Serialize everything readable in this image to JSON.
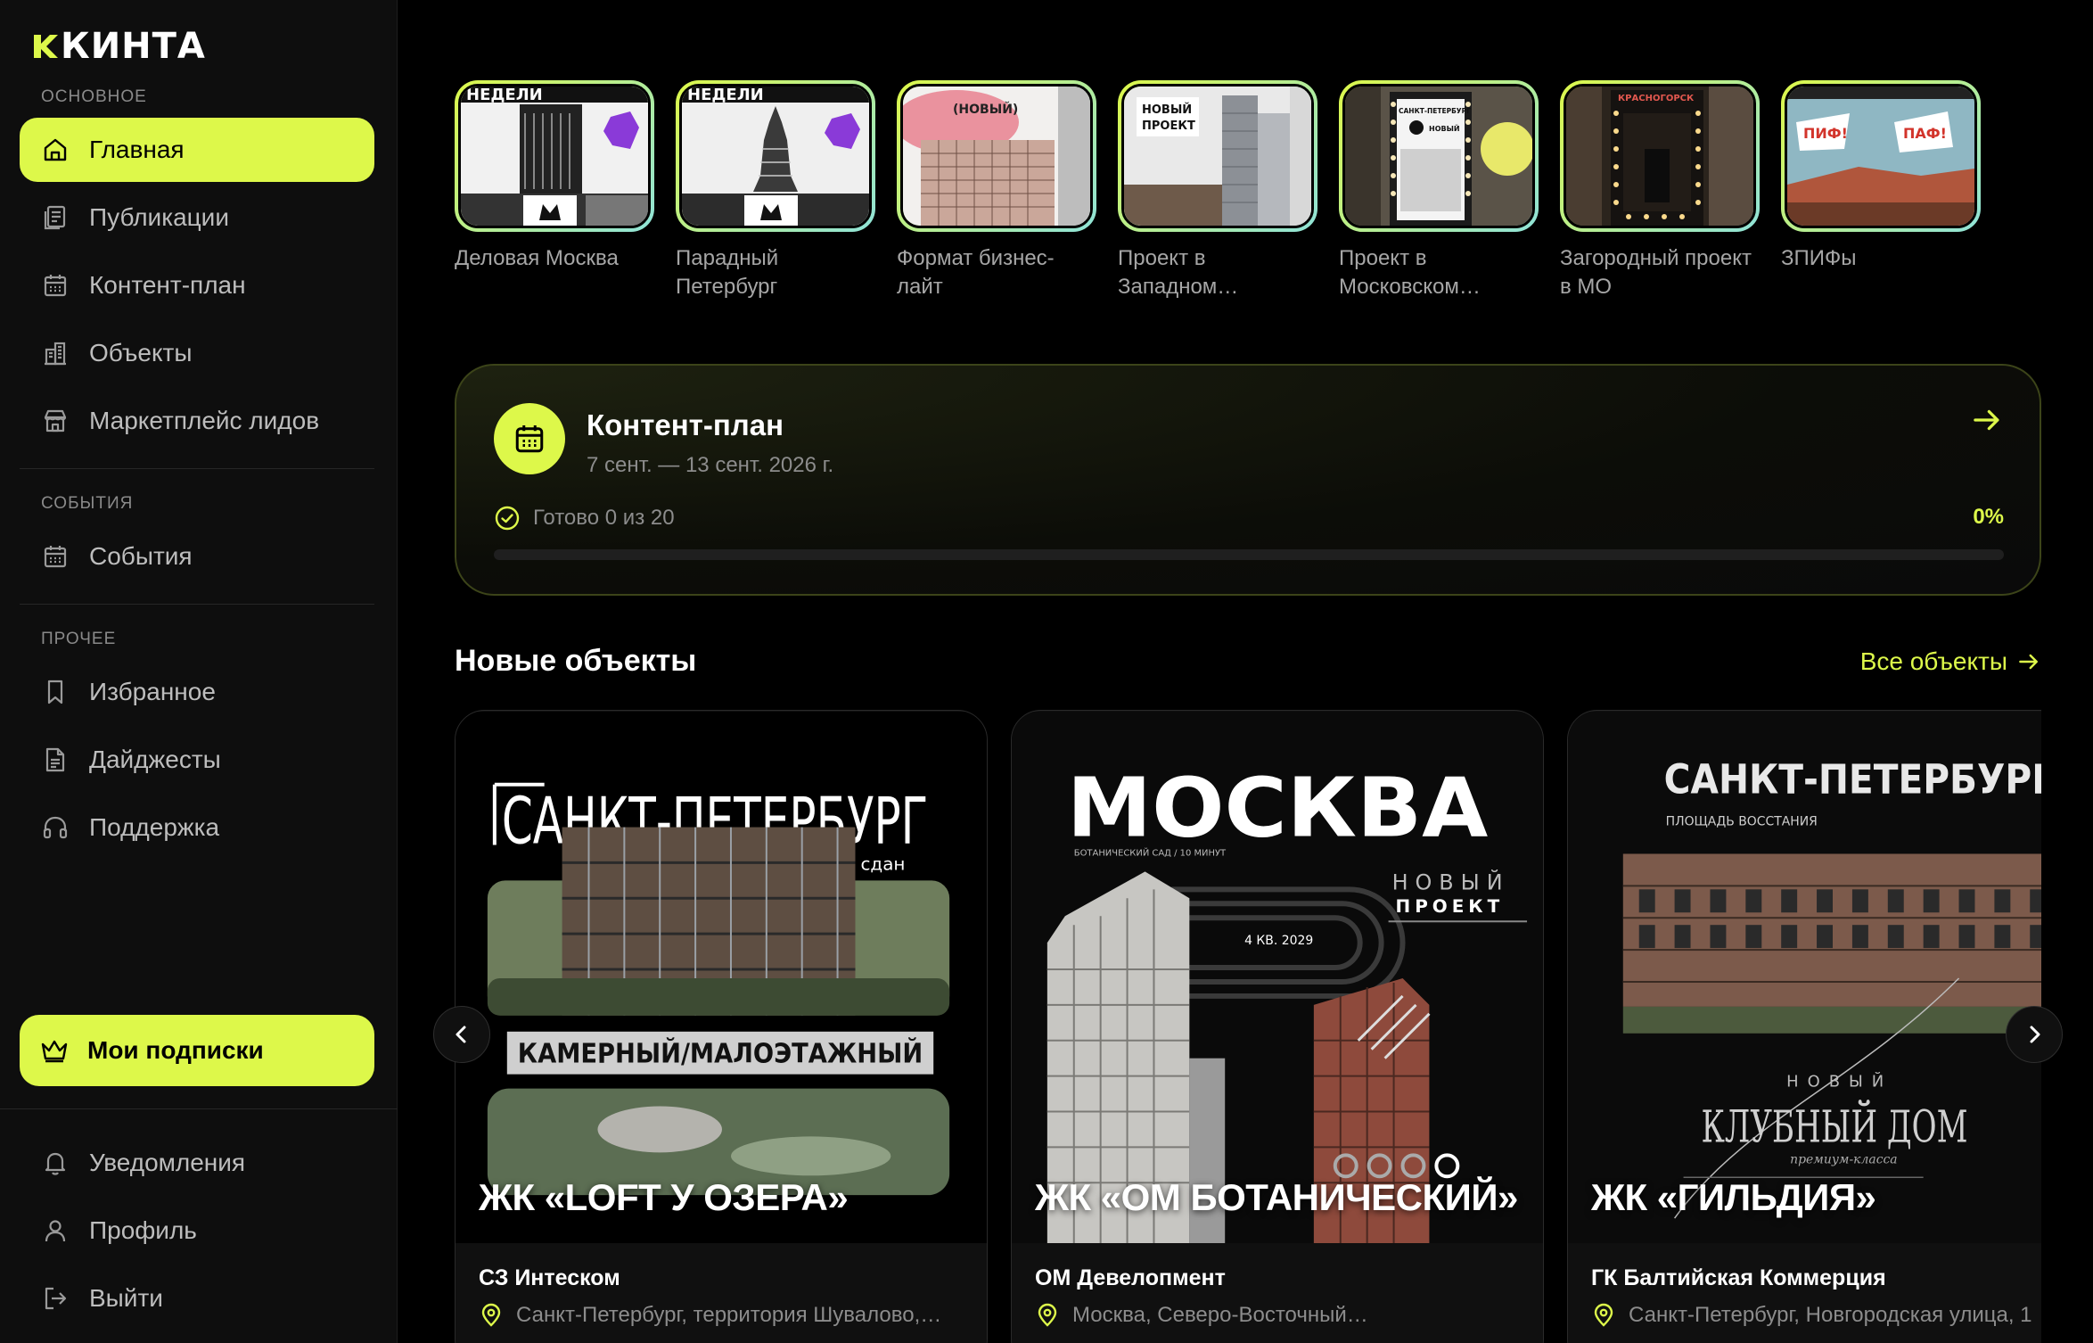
{
  "brand": {
    "name": "КИНТА",
    "accent": "#DDF84A"
  },
  "sidebar": {
    "sections": {
      "main": "ОСНОВНОЕ",
      "events": "СОБЫТИЯ",
      "other": "ПРОЧЕЕ"
    },
    "items": [
      {
        "label": "Главная",
        "icon": "home-icon",
        "active": true
      },
      {
        "label": "Публикации",
        "icon": "publications-icon"
      },
      {
        "label": "Контент-план",
        "icon": "calendar-icon"
      },
      {
        "label": "Объекты",
        "icon": "buildings-icon"
      },
      {
        "label": "Маркетплейс лидов",
        "icon": "store-icon"
      },
      {
        "label": "События",
        "icon": "calendar-icon"
      },
      {
        "label": "Избранное",
        "icon": "bookmark-icon"
      },
      {
        "label": "Дайджесты",
        "icon": "document-icon"
      },
      {
        "label": "Поддержка",
        "icon": "headphones-icon"
      }
    ],
    "subscriptions": {
      "label": "Мои подписки",
      "icon": "crown-icon"
    },
    "bottom": [
      {
        "label": "Уведомления",
        "icon": "bell-icon"
      },
      {
        "label": "Профиль",
        "icon": "user-icon"
      },
      {
        "label": "Выйти",
        "icon": "logout-icon"
      }
    ]
  },
  "stories": [
    {
      "label": "Деловая Москва"
    },
    {
      "label": "Парадный Петербург"
    },
    {
      "label": "Формат бизнес-лайт"
    },
    {
      "label": "Проект в Западном…"
    },
    {
      "label": "Проект в Московском…"
    },
    {
      "label": "Загородный проект в МО"
    },
    {
      "label": "ЗПИФы"
    }
  ],
  "content_plan": {
    "title": "Контент-план",
    "dates": "7 сент. — 13 сент. 2026 г.",
    "ready": "Готово 0 из 20",
    "percent_label": "0%",
    "progress": 0
  },
  "new_objects": {
    "title": "Новые объекты",
    "see_all": "Все объекты",
    "cards": [
      {
        "name": "ЖК «LOFT У ОЗЕРА»",
        "developer": "СЗ Интеском",
        "address": "Санкт-Петербург, территория Шувалово,…"
      },
      {
        "name": "ЖК «ОМ БОТАНИЧЕСКИЙ»",
        "developer": "ОМ Девелопмент",
        "address": "Москва, Северо-Восточный…"
      },
      {
        "name": "ЖК «ГИЛЬДИЯ»",
        "developer": "ГК Балтийская Коммерция",
        "address": "Санкт-Петербург, Новгородская улица, 1"
      }
    ]
  },
  "card_art": {
    "card1": {
      "city": "САНКТ-ПЕТЕРБУРГ",
      "status": "сдан",
      "format": "КАМЕРНЫЙ/МАЛОЭТАЖНЫЙ"
    },
    "card2": {
      "city": "МОСКВА",
      "metro": "БОТАНИЧЕСКИЙ САД / 10 МИНУТ",
      "tag1": "НОВЫЙ",
      "tag2": "ПРОЕКТ",
      "date": "4 КВ. 2029"
    },
    "card3": {
      "city": "САНКТ-ПЕТЕРБУРГ",
      "area": "ПЛОЩАДЬ ВОССТАНИЯ",
      "tag": "НОВЫЙ",
      "kind": "КЛУБНЫЙ ДОМ",
      "cls": "премиум-класса"
    }
  },
  "story_art": {
    "s1": {
      "headline": "НЕДЕЛИ"
    },
    "s2": {
      "headline": "НЕДЕЛИ"
    },
    "s3": {
      "tag": "(НОВЫЙ)"
    },
    "s4": {
      "l1": "НОВЫЙ",
      "l2": "ПРОЕКТ"
    },
    "s5": {
      "l1": "САНКТ-ПЕТЕРБУРГ",
      "l2": "НОВЫЙ"
    },
    "s6": {
      "l1": "КРАСНОГОРСК"
    },
    "s7": {
      "l1": "ПИФ!",
      "l2": "ПАФ!"
    }
  }
}
